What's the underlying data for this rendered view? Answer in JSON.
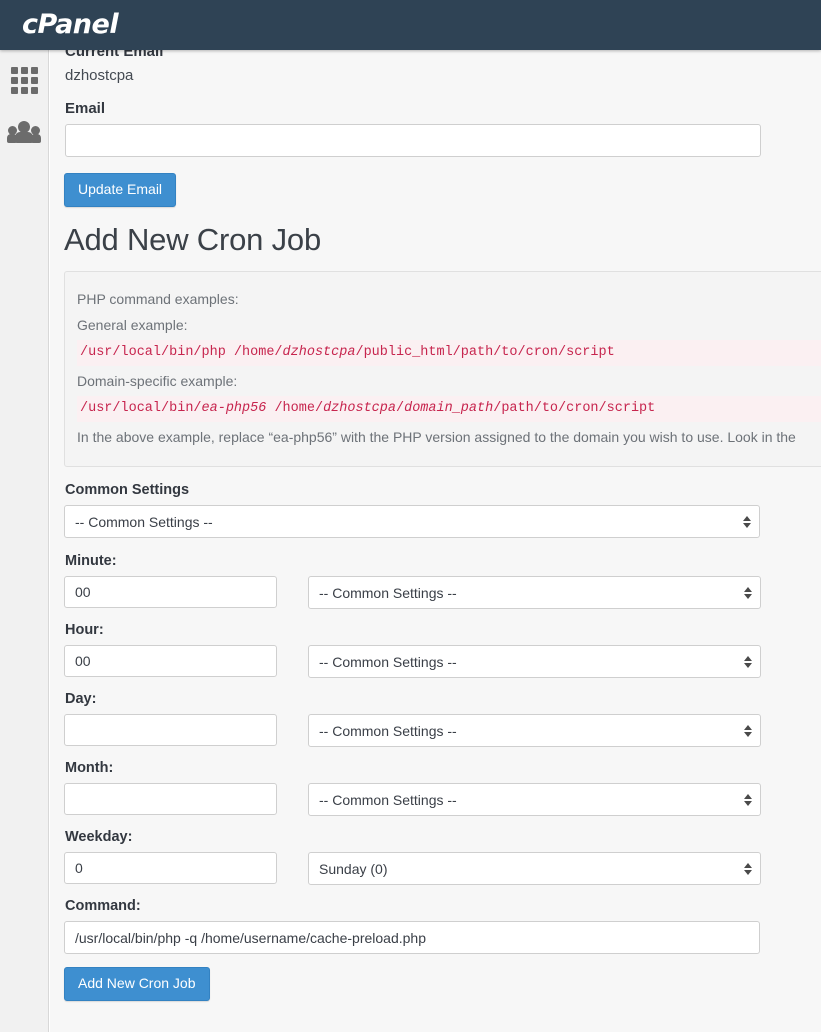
{
  "header": {
    "logo_text": "cPanel",
    "bg_color": "#2f4355"
  },
  "sidebar": {
    "items": [
      {
        "name": "apps-grid",
        "icon": "grid-icon"
      },
      {
        "name": "users",
        "icon": "users-icon"
      }
    ]
  },
  "email_section": {
    "current_email_label": "Current Email",
    "current_email_value": "dzhostcpa",
    "email_label": "Email",
    "email_value": "",
    "email_placeholder": "",
    "update_button_label": "Update Email"
  },
  "main": {
    "heading": "Add New Cron Job"
  },
  "info_panel": {
    "title": "PHP command examples:",
    "general_label": "General example:",
    "general_code_prefix": "/usr/local/bin/php /home/",
    "general_code_user": "dzhostcpa",
    "general_code_suffix": "/public_html/path/to/cron/script",
    "domain_label": "Domain-specific example:",
    "domain_code_p1": "/usr/local/bin/",
    "domain_code_phpver": "ea-php56",
    "domain_code_p2": " /home/",
    "domain_code_user": "dzhostcpa",
    "domain_code_p3": "/",
    "domain_code_path": "domain_path",
    "domain_code_p4": "/path/to/cron/script",
    "note": "In the above example, replace “ea-php56” with the PHP version assigned to the domain you wish to use. Look in the"
  },
  "form": {
    "common_settings_label": "Common Settings",
    "common_settings_value": "-- Common Settings --",
    "minute": {
      "label": "Minute:",
      "value": "00",
      "select_value": "-- Common Settings --"
    },
    "hour": {
      "label": "Hour:",
      "value": "00",
      "select_value": "-- Common Settings --"
    },
    "day": {
      "label": "Day:",
      "value": "",
      "select_value": "-- Common Settings --"
    },
    "month": {
      "label": "Month:",
      "value": "",
      "select_value": "-- Common Settings --"
    },
    "weekday": {
      "label": "Weekday:",
      "value": "0",
      "select_value": "Sunday (0)"
    },
    "command": {
      "label": "Command:",
      "value": "/usr/local/bin/php -q /home/username/cache-preload.php"
    },
    "submit_label": "Add New Cron Job"
  },
  "colors": {
    "accent_blue": "#3e8fd0",
    "code_red": "#c7254e",
    "header_navy": "#2f4355"
  }
}
